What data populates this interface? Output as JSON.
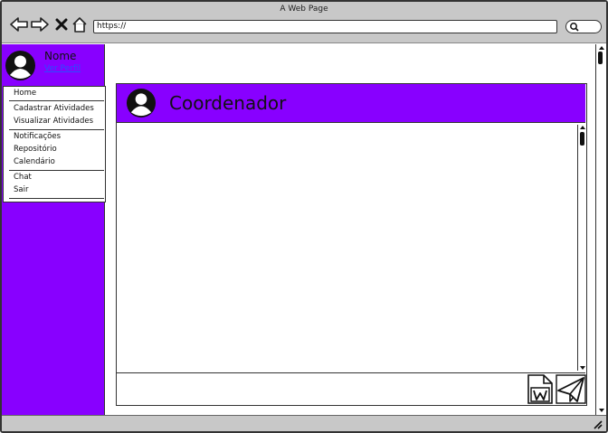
{
  "window": {
    "title": "A Web Page",
    "url": "https://"
  },
  "profile": {
    "name": "Nome",
    "link_label": "Ver Perfil"
  },
  "menu": {
    "groups": [
      [
        "Home"
      ],
      [
        "Cadastrar Atividades",
        "Visualizar Atividades"
      ],
      [
        "Notificações",
        "Repositório",
        "Calendário"
      ],
      [
        "Chat",
        "Sair"
      ]
    ]
  },
  "chat": {
    "title": "Coordenador",
    "message_input_value": ""
  },
  "colors": {
    "accent": "#8800ff",
    "chrome": "#c8c8c8",
    "link": "#2a4dff"
  },
  "icons": [
    "back-arrow-icon",
    "forward-arrow-icon",
    "close-icon",
    "home-icon",
    "search-icon",
    "avatar-icon",
    "word-document-icon",
    "paper-plane-icon",
    "resize-grip-icon"
  ]
}
